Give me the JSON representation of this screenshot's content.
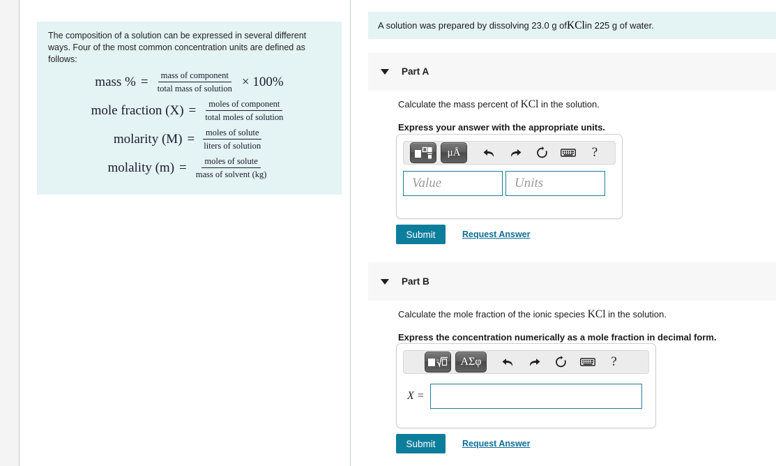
{
  "left_panel": {
    "intro_text": "The composition of a solution can be expressed in several different ways. Four of the most common concentration units are defined as follows:",
    "formulas": [
      {
        "lhs": "mass %",
        "eq": "=",
        "numerator": "mass of component",
        "denominator": "total mass of solution",
        "tail": "× 100%"
      },
      {
        "lhs": "mole fraction (X)",
        "eq": "=",
        "numerator": "moles of component",
        "denominator": "total moles of solution",
        "tail": ""
      },
      {
        "lhs": "molarity (M)",
        "eq": "=",
        "numerator": "moles of solute",
        "denominator": "liters of solution",
        "tail": ""
      },
      {
        "lhs": "molality (m)",
        "eq": "=",
        "numerator": "moles of solute",
        "denominator": "mass of solvent (kg)",
        "tail": ""
      }
    ]
  },
  "question": {
    "before_chem": "A solution was prepared by dissolving 23.0 g of ",
    "chem": "KCl",
    "after_chem": " in 225 g of water."
  },
  "part_a": {
    "title": "Part A",
    "caret_icon": "caret-down-icon",
    "prompt_before_chem": "Calculate the mass percent of ",
    "prompt_chem": "KCl",
    "prompt_after_chem": " in the solution.",
    "instruction": "Express your answer with the appropriate units.",
    "toolbar": {
      "template_button": "template-icon",
      "units_button": "μÅ",
      "undo": "undo-icon",
      "redo": "redo-icon",
      "reset": "reset-icon",
      "keyboard": "keyboard-icon",
      "help": "?"
    },
    "value_placeholder": "Value",
    "units_placeholder": "Units",
    "value_current": "",
    "units_current": "",
    "submit_label": "Submit",
    "request_answer_label": "Request Answer"
  },
  "part_b": {
    "title": "Part B",
    "caret_icon": "caret-down-icon",
    "prompt_before_chem": "Calculate the mole fraction of the ionic species ",
    "prompt_chem": "KCl",
    "prompt_after_chem": " in the solution.",
    "instruction": "Express the concentration numerically as a mole fraction in decimal form.",
    "toolbar": {
      "template_button": "radical-template-icon",
      "greek_button": "ΑΣφ",
      "undo": "undo-icon",
      "redo": "redo-icon",
      "reset": "reset-icon",
      "keyboard": "keyboard-icon",
      "help": "?"
    },
    "x_label": "X =",
    "x_value": "",
    "submit_label": "Submit",
    "request_answer_label": "Request Answer"
  },
  "colors": {
    "accent_teal": "#0d7d9c",
    "field_border": "#177e96",
    "tint_panel": "#e4f3f3",
    "header_band": "#f7f7f7",
    "link": "#0d6f96"
  }
}
